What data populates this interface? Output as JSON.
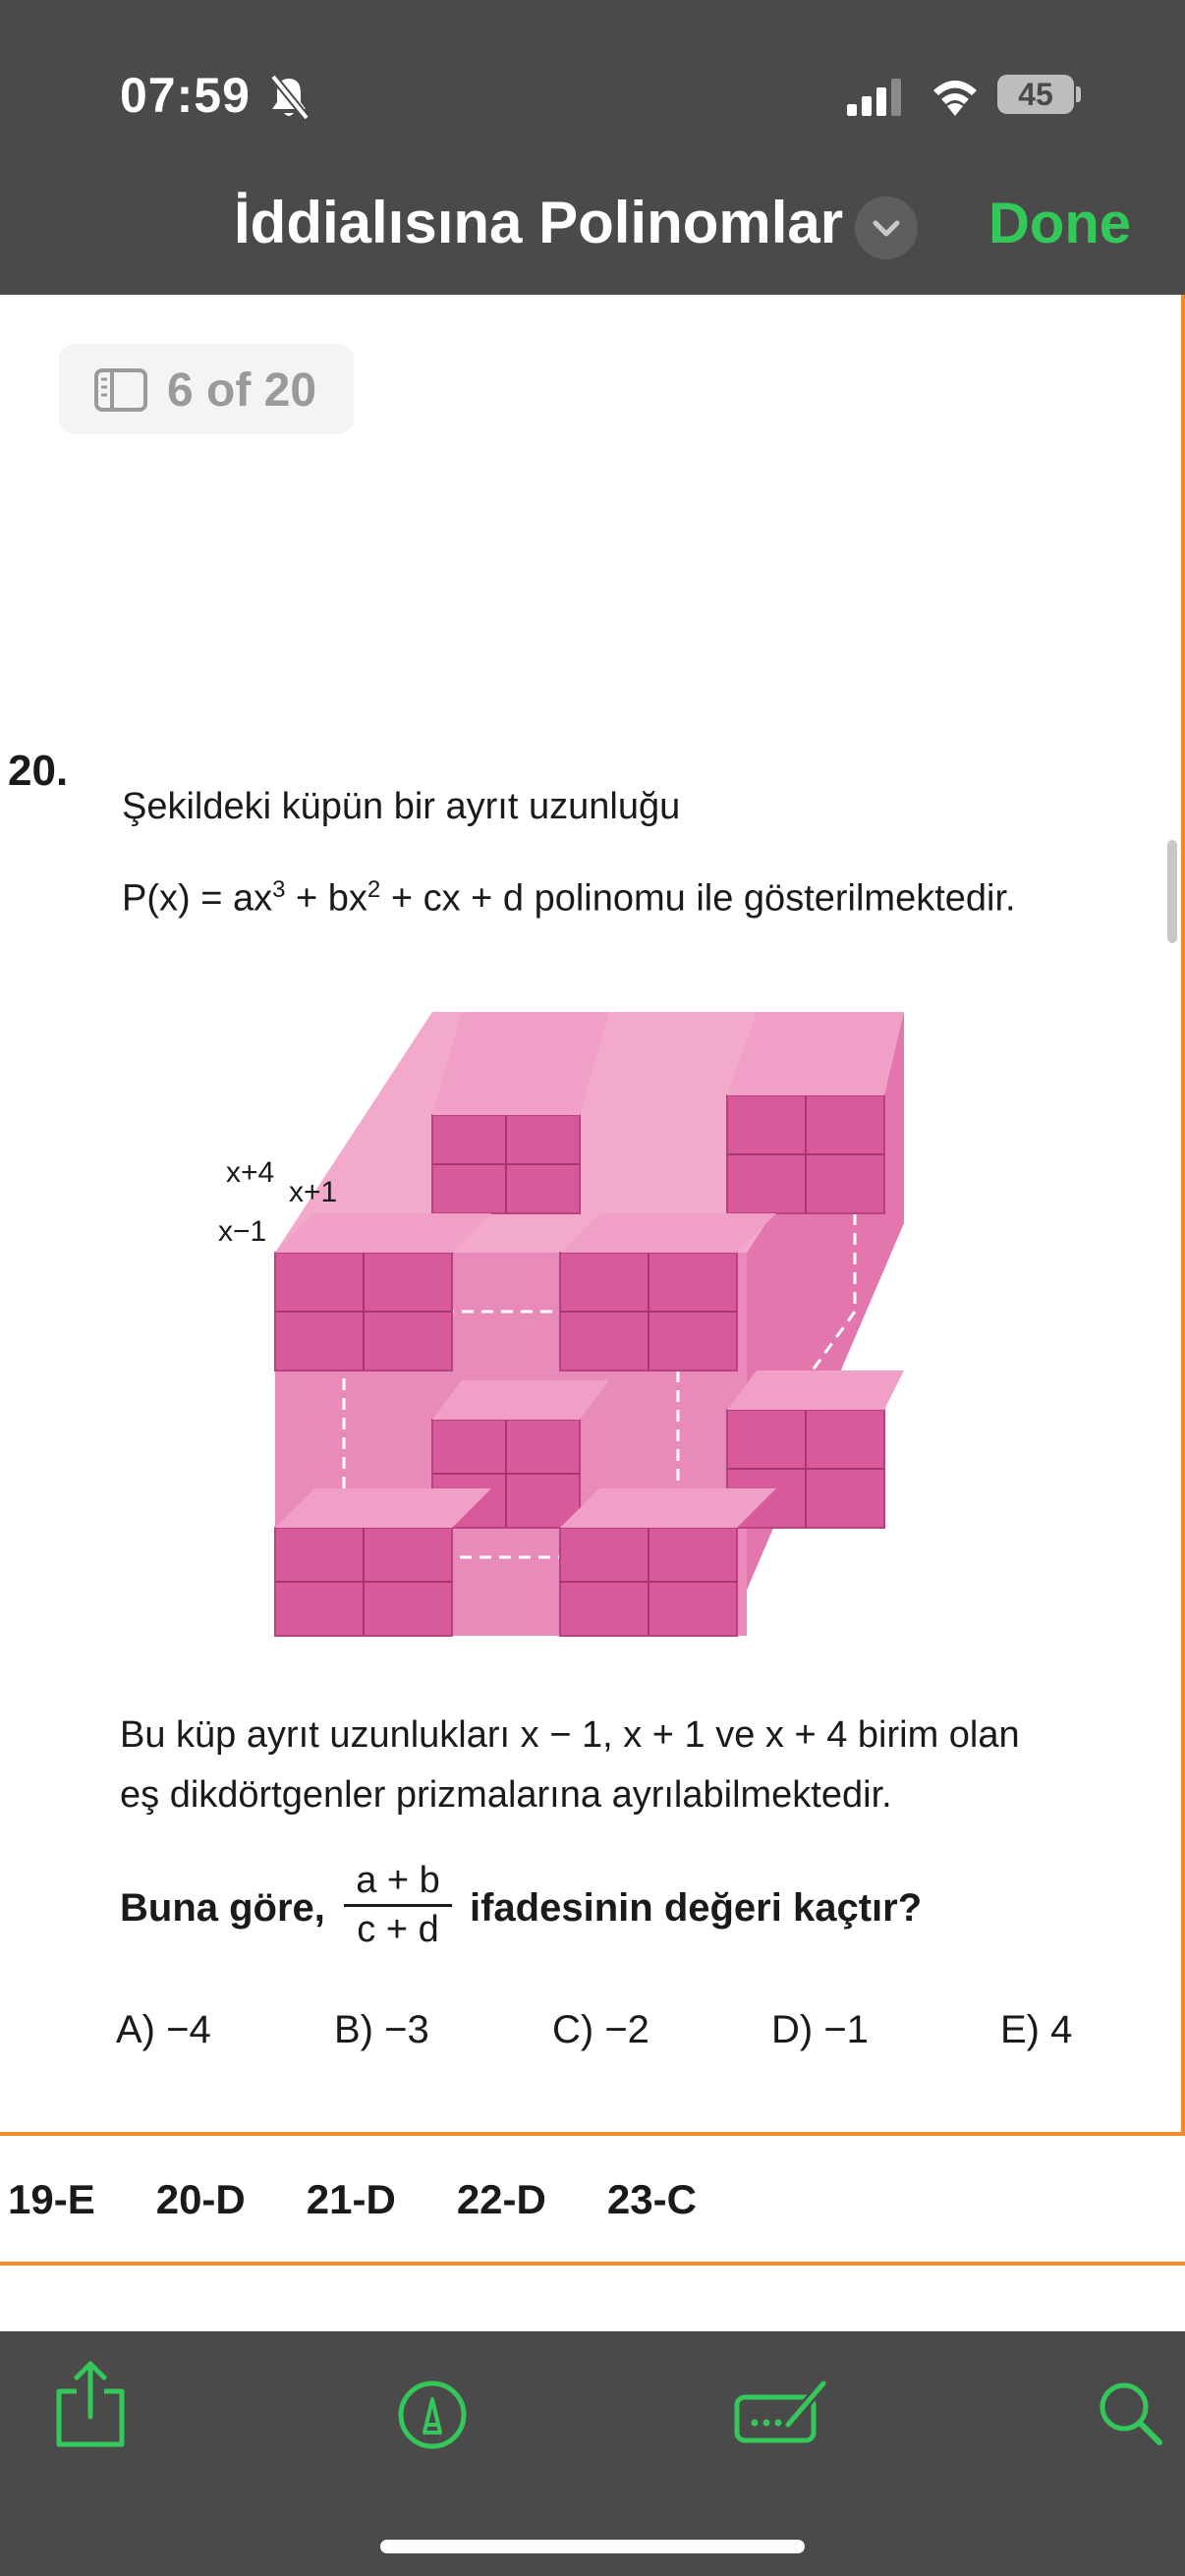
{
  "status_bar": {
    "time": "07:59",
    "battery": "45",
    "icons": [
      "bell-slash-icon",
      "cellular-signal-icon",
      "wifi-icon",
      "battery-icon"
    ]
  },
  "header": {
    "title": "İddialısına Polinomlar",
    "done_label": "Done",
    "accent": "#34c759"
  },
  "page_indicator": {
    "label": "6 of 20"
  },
  "question": {
    "number": "20.",
    "line1": "Şekildeki küpün bir ayrıt uzunluğu",
    "poly": {
      "lhs": "P(x) = ax",
      "e1": "3",
      "p2": " + bx",
      "e2": "2",
      "rest": " + cx + d  polinomu ile gösterilmektedir."
    },
    "figure_labels": {
      "a": "x+4",
      "b": "x+1",
      "c": "x−1"
    },
    "line3": "Bu küp ayrıt uzunlukları  x − 1,  x + 1  ve  x + 4  birim olan",
    "line4": "eş dikdörtgenler prizmalarına ayrılabilmektedir.",
    "prompt_before": "Buna göre,",
    "frac_num": "a + b",
    "frac_den": "c + d",
    "prompt_after": "ifadesinin değeri kaçtır?",
    "options": [
      "A) −4",
      "B) −3",
      "C) −2",
      "D) −1",
      "E) 4"
    ]
  },
  "answers": [
    "19-E",
    "20-D",
    "21-D",
    "22-D",
    "23-C"
  ],
  "colors": {
    "toolbar": "#4a4a4a",
    "divider": "#f08a2c",
    "cube": "#e06ba5"
  },
  "toolbar_icons": [
    "share-icon",
    "markup-icon",
    "signature-icon",
    "search-icon"
  ]
}
